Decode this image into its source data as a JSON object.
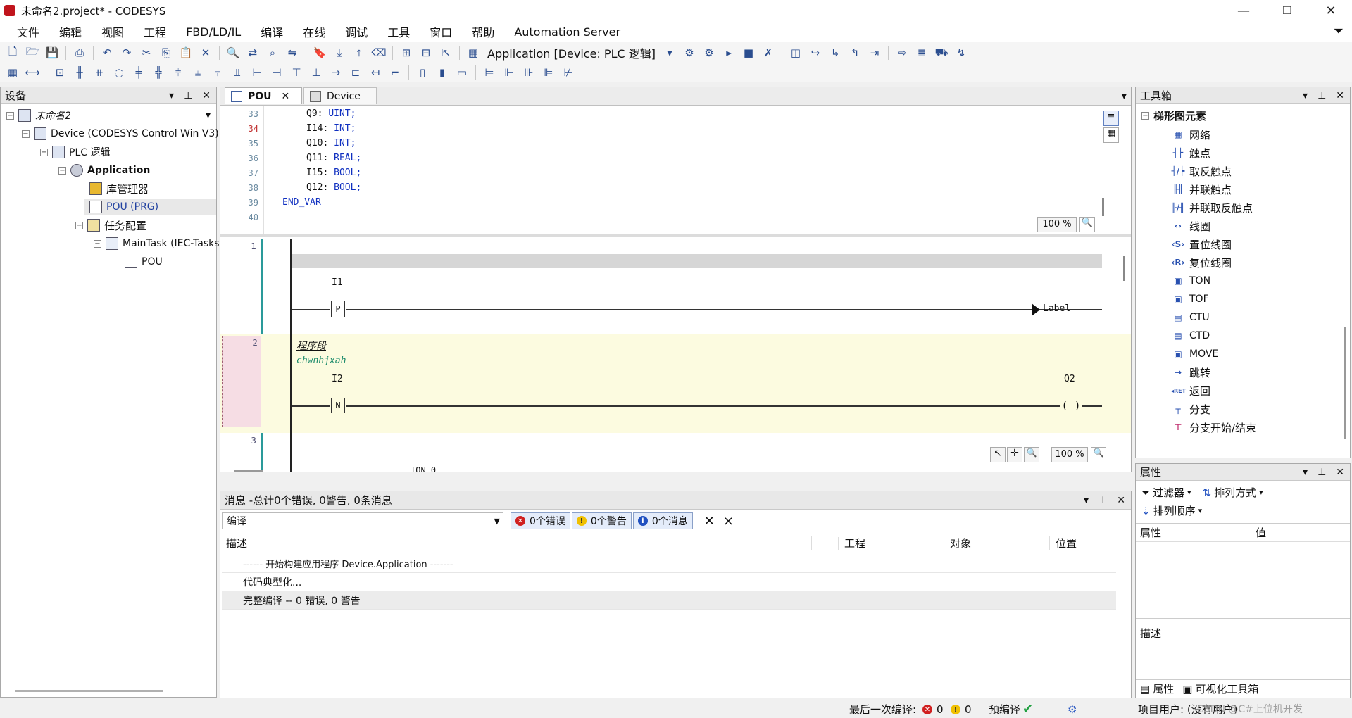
{
  "window": {
    "title": "未命名2.project* - CODESYS",
    "minimize": "—",
    "maximize": "❐",
    "close": "✕"
  },
  "menu": [
    "文件",
    "编辑",
    "视图",
    "工程",
    "FBD/LD/IL",
    "编译",
    "在线",
    "调试",
    "工具",
    "窗口",
    "帮助",
    "Automation Server"
  ],
  "toolbar": {
    "app_selector": "Application [Device: PLC 逻辑]"
  },
  "devices_panel": {
    "title": "设备",
    "tree": [
      {
        "label": "未命名2",
        "level": 0
      },
      {
        "label": "Device (CODESYS Control Win V3)",
        "level": 1
      },
      {
        "label": "PLC 逻辑",
        "level": 2
      },
      {
        "label": "Application",
        "level": 3
      },
      {
        "label": "库管理器",
        "level": 4
      },
      {
        "label": "POU (PRG)",
        "level": 4
      },
      {
        "label": "任务配置",
        "level": 4
      },
      {
        "label": "MainTask (IEC-Tasks)",
        "level": 5
      },
      {
        "label": "POU",
        "level": 6
      }
    ]
  },
  "editor": {
    "tabs": [
      "POU",
      "Device"
    ],
    "declaration_lines": [
      {
        "no": "33",
        "name": "Q9:",
        "type": "UINT;"
      },
      {
        "no": "34",
        "name": "I14:",
        "type": "INT;"
      },
      {
        "no": "35",
        "name": "Q10:",
        "type": "INT;"
      },
      {
        "no": "36",
        "name": "Q11:",
        "type": "REAL;"
      },
      {
        "no": "37",
        "name": "I15:",
        "type": "BOOL;"
      },
      {
        "no": "38",
        "name": "Q12:",
        "type": "BOOL;"
      },
      {
        "no": "39",
        "name": "END_VAR",
        "type": ""
      },
      {
        "no": "40",
        "name": "",
        "type": ""
      }
    ],
    "decl_zoom": "100 %",
    "ld_zoom": "100 %",
    "networks": {
      "n1": "1",
      "n2": "2",
      "n3": "3",
      "n1_contact_var": "I1",
      "n1_contact_mark": "P",
      "n1_jump_label": "Label",
      "n2_title": "程序段",
      "n2_comment": "chwnhjxah",
      "n2_contact_var": "I2",
      "n2_contact_mark": "N",
      "n2_coil_var": "Q2",
      "n2_coil": "( )",
      "n3_partial": "TON_0"
    }
  },
  "messages": {
    "header": "消息 -总计0个错误, 0警告, 0条消息",
    "category": "编译",
    "errors": "0个错误",
    "warnings": "0个警告",
    "infos": "0个消息",
    "columns": [
      "描述",
      "工程",
      "对象",
      "位置"
    ],
    "rows": [
      "------ 开始构建应用程序 Device.Application -------",
      "代码典型化...",
      "完整编译 -- 0 错误, 0 警告"
    ]
  },
  "toolbox": {
    "title": "工具箱",
    "group": "梯形图元素",
    "items": [
      {
        "icon": "▦",
        "label": "网络"
      },
      {
        "icon": "┤┝",
        "label": "触点"
      },
      {
        "icon": "┤/┝",
        "label": "取反触点"
      },
      {
        "icon": "╟╢",
        "label": "并联触点"
      },
      {
        "icon": "╟/╢",
        "label": "并联取反触点"
      },
      {
        "icon": "‹›",
        "label": "线圈"
      },
      {
        "icon": "‹S›",
        "label": "置位线圈"
      },
      {
        "icon": "‹R›",
        "label": "复位线圈"
      },
      {
        "icon": "▣",
        "label": "TON"
      },
      {
        "icon": "▣",
        "label": "TOF"
      },
      {
        "icon": "▤",
        "label": "CTU"
      },
      {
        "icon": "▤",
        "label": "CTD"
      },
      {
        "icon": "▣",
        "label": "MOVE"
      },
      {
        "icon": "→",
        "label": "跳转"
      },
      {
        "icon": "◂RET",
        "label": "返回"
      },
      {
        "icon": "┬",
        "label": "分支"
      },
      {
        "icon": "⊤",
        "label": "分支开始/结束"
      }
    ]
  },
  "properties": {
    "title": "属性",
    "filter": "过滤器",
    "sort_by": "排列方式",
    "sort_order": "排列顺序",
    "col_prop": "属性",
    "col_value": "值",
    "desc": "描述",
    "tab1": "属性",
    "tab2": "可视化工具箱"
  },
  "status": {
    "last_compile": "最后一次编译:",
    "errors": "0",
    "warnings": "0",
    "precompile": "预编译",
    "user": "项目用户: (没有用户)",
    "watermark": "CSDN @C#上位机开发"
  }
}
